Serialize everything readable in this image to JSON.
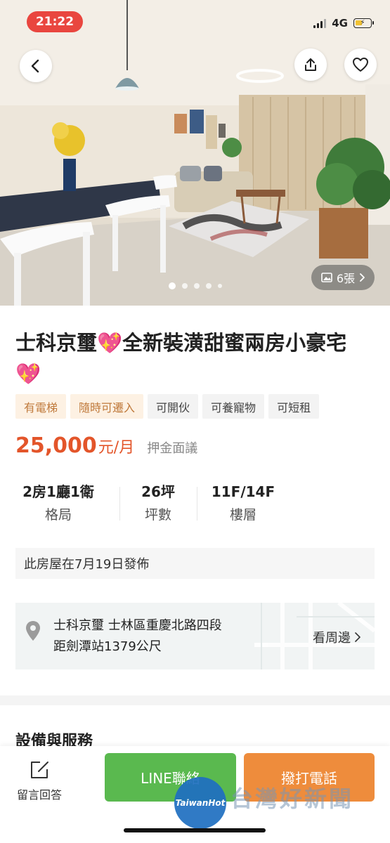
{
  "status_bar": {
    "time": "21:22",
    "network": "4G"
  },
  "gallery": {
    "photo_count": "6張",
    "total_dots": 5,
    "active_index": 0
  },
  "listing": {
    "title": "士科京璽💖全新裝潢甜蜜兩房小豪宅💖",
    "tags": [
      {
        "label": "有電梯",
        "highlight": true
      },
      {
        "label": "隨時可遷入",
        "highlight": true
      },
      {
        "label": "可開伙",
        "highlight": false
      },
      {
        "label": "可養寵物",
        "highlight": false
      },
      {
        "label": "可短租",
        "highlight": false
      }
    ],
    "price": "25,000",
    "price_unit": "元/月",
    "deposit": "押金面議",
    "stats": [
      {
        "value": "2房1廳1衛",
        "label": "格局"
      },
      {
        "value": "26坪",
        "label": "坪數"
      },
      {
        "value": "11F/14F",
        "label": "樓層"
      }
    ],
    "published": "此房屋在7月19日發佈",
    "location": {
      "address": "士科京璽 士林區重慶北路四段",
      "distance": "距劍潭站1379公尺",
      "link_label": "看周邊"
    }
  },
  "sections": {
    "facilities_title": "設備與服務"
  },
  "bottom_bar": {
    "reply_label": "留言回答",
    "line_label": "LINE聯絡",
    "call_label": "撥打電話"
  },
  "watermark": {
    "badge": "TaiwanHot",
    "text": "台灣好新聞"
  },
  "colors": {
    "accent_orange": "#e3552a",
    "tag_highlight_bg": "#fdf1e3",
    "line_green": "#5ab94f",
    "call_orange": "#ee8c3c",
    "status_pill": "#e9463f"
  }
}
